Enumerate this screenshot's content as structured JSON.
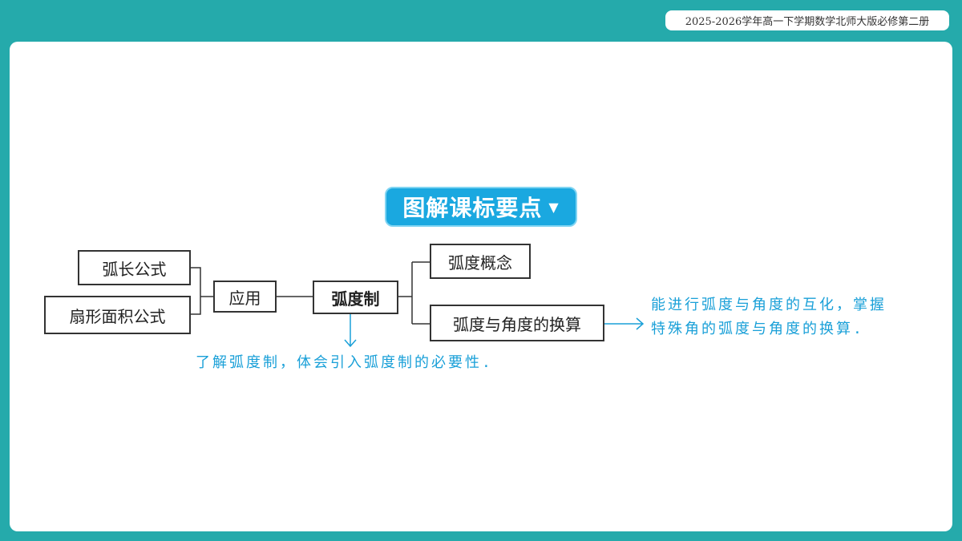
{
  "header": {
    "course": "2025-2026学年高一下学期数学北师大版必修第二册"
  },
  "title": {
    "text": "图解课标要点",
    "arrow": "▼"
  },
  "diagram": {
    "nodes": {
      "arc_length": "弧长公式",
      "sector_area": "扇形面积公式",
      "application": "应用",
      "radian": "弧度制",
      "radian_concept": "弧度概念",
      "conversion": "弧度与角度的换算"
    },
    "notes": {
      "bottom": "了解弧度制，体会引入弧度制的必要性.",
      "right_line1": "能进行弧度与角度的互化，掌握",
      "right_line2": "特殊角的弧度与角度的换算."
    }
  },
  "colors": {
    "frame": "#25aaab",
    "banner": "#1aa8e0",
    "note_text": "#1aa0d8"
  }
}
